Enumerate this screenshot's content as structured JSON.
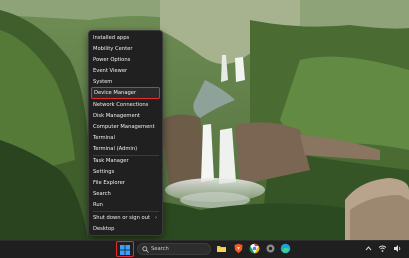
{
  "menu": {
    "items": [
      {
        "label": "Installed apps"
      },
      {
        "label": "Mobility Center"
      },
      {
        "label": "Power Options"
      },
      {
        "label": "Event Viewer"
      },
      {
        "label": "System"
      },
      {
        "label": "Device Manager",
        "highlighted": true
      },
      {
        "label": "Network Connections"
      },
      {
        "label": "Disk Management"
      },
      {
        "label": "Computer Management"
      },
      {
        "label": "Terminal"
      },
      {
        "label": "Terminal (Admin)"
      },
      {
        "label": "Task Manager"
      },
      {
        "label": "Settings"
      },
      {
        "label": "File Explorer"
      },
      {
        "label": "Search"
      },
      {
        "label": "Run"
      },
      {
        "label": "Shut down or sign out",
        "submenu_arrow": "›"
      },
      {
        "label": "Desktop"
      }
    ]
  },
  "taskbar": {
    "search_label": "Search",
    "apps": [
      "file-explorer-icon",
      "brave-icon",
      "chrome-icon",
      "settings-icon",
      "edge-icon"
    ]
  },
  "colors": {
    "highlight_border": "#e32d2d",
    "menu_bg": "#202020",
    "taskbar_bg": "#1f1f1f"
  }
}
